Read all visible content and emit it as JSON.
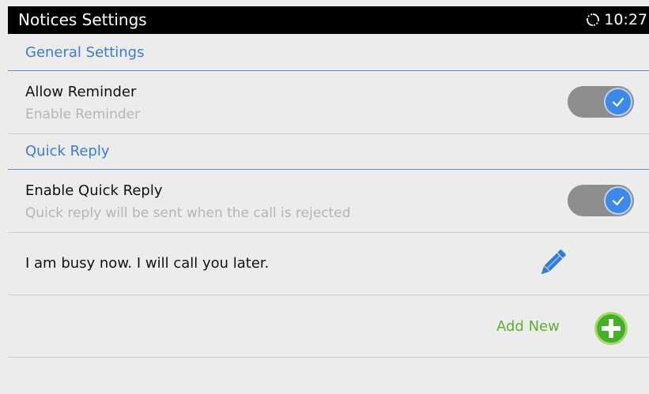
{
  "status_bar": {
    "title": "Notices Settings",
    "time": "10:27",
    "sync_icon": "sync-icon"
  },
  "general_settings": {
    "header": "General Settings",
    "allow_reminder": {
      "title": "Allow Reminder",
      "subtitle": "Enable Reminder",
      "enabled": true
    }
  },
  "quick_reply": {
    "header": "Quick Reply",
    "enable_quick_reply": {
      "title": "Enable Quick Reply",
      "subtitle": "Quick reply will be sent when the call is rejected",
      "enabled": true
    },
    "messages": [
      {
        "text": "I am busy now. I will call you later.",
        "edit_icon": "pencil-icon"
      }
    ],
    "add_new_label": "Add New",
    "add_icon": "plus-circle-icon"
  },
  "colors": {
    "accent": "#3a7bd5",
    "toggle_on": "#3d89e8",
    "add_green": "#5faf2e",
    "status_bar_bg": "#000000"
  }
}
